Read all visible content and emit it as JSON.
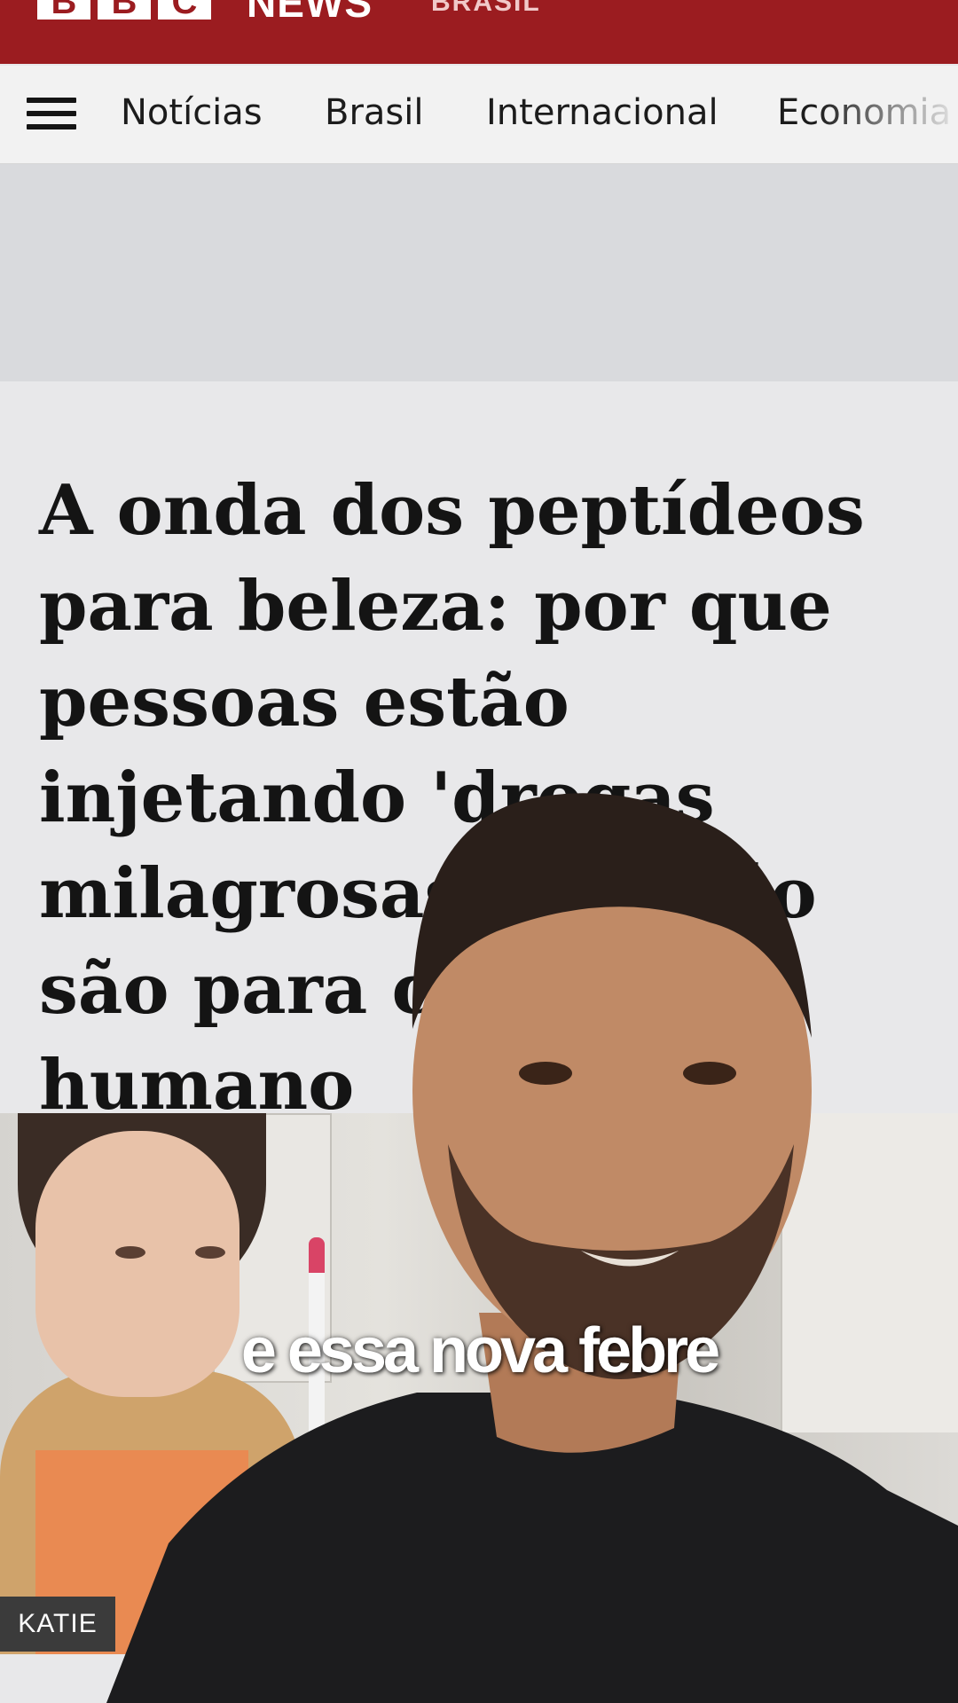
{
  "masthead": {
    "brand_letters": [
      "B",
      "B",
      "C"
    ],
    "brand_news": "NEWS",
    "brand_edition": "BRASIL",
    "color": "#9b1c20"
  },
  "nav": {
    "menu_icon": "hamburger-menu-icon",
    "items": [
      "Notícias",
      "Brasil",
      "Internacional",
      "Economia"
    ]
  },
  "article": {
    "headline": "A onda dos peptídeos para beleza: por que pessoas estão injetando 'drogas milagrosas' que não são para consumo humano",
    "photo_caption": "KATIE"
  },
  "overlay": {
    "subtitle": "e essa nova febre"
  }
}
